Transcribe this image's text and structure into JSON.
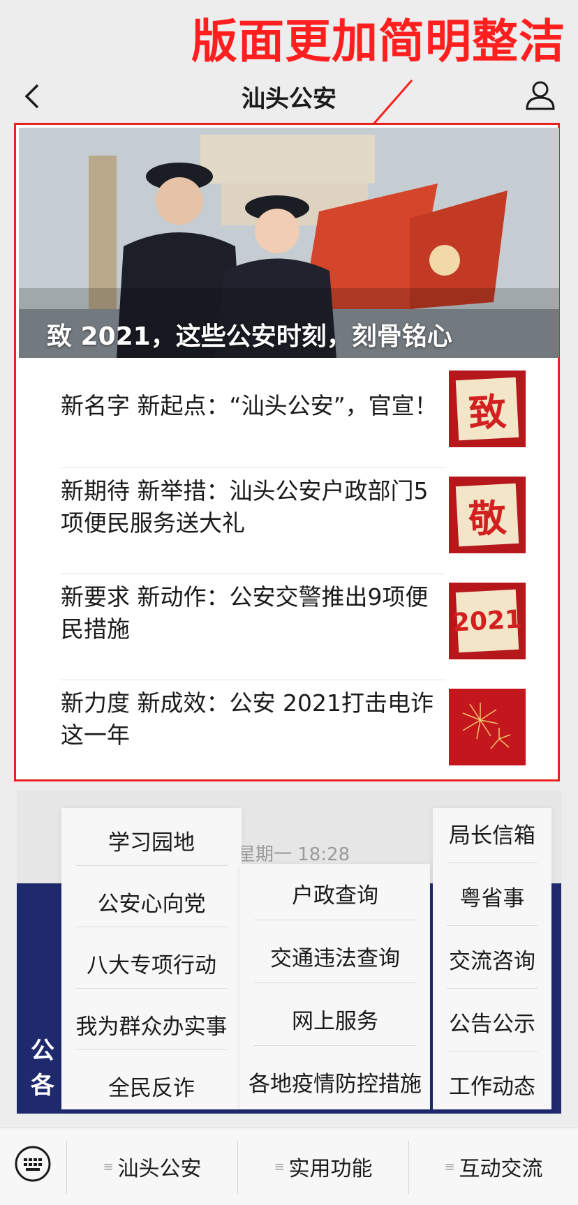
{
  "annotation": "版面更加简明整洁",
  "navbar": {
    "title": "汕头公安"
  },
  "banner": {
    "caption": "致 2021，这些公安时刻，刻骨铭心"
  },
  "news": [
    {
      "title": "新名字 新起点：“汕头公安”，官宣！",
      "thumb": "致"
    },
    {
      "title": "新期待 新举措：汕头公安户政部门5项便民服务送大礼",
      "thumb": "敬"
    },
    {
      "title": "新要求 新动作：公安交警推出9项便民措施",
      "thumb": "2021"
    },
    {
      "title": "新力度 新成效：公安 2021打击电诈这一年",
      "thumb": ""
    }
  ],
  "timestamp": "星期一 18:28",
  "background_text": [
    "公",
    "各"
  ],
  "menus": {
    "left": [
      "学习园地",
      "公安心向党",
      "八大专项行动",
      "我为群众办实事",
      "全民反诈"
    ],
    "middle": [
      "户政查询",
      "交通违法查询",
      "网上服务",
      "各地疫情防控措施"
    ],
    "right": [
      "局长信箱",
      "粤省事",
      "交流咨询",
      "公告公示",
      "工作动态"
    ]
  },
  "tabbar": {
    "tabs": [
      "汕头公安",
      "实用功能",
      "互动交流"
    ],
    "bars_glyph": "≡"
  },
  "colors": {
    "annotation": "#ff1f1f",
    "highlight_border": "#e8231f",
    "thumb_red": "#b5171b"
  }
}
